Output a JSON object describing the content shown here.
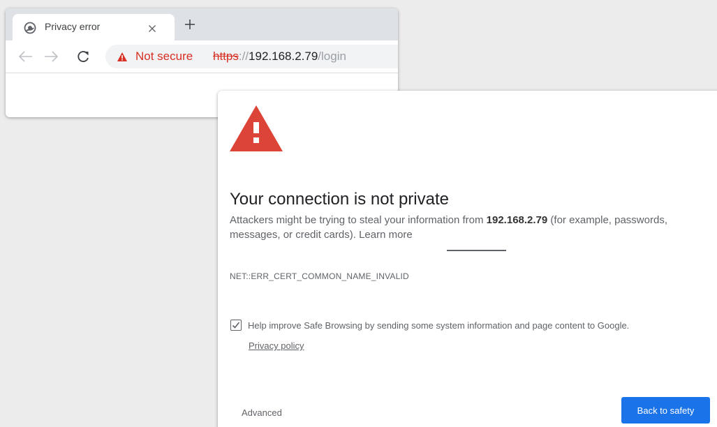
{
  "browser": {
    "tab": {
      "title": "Privacy error"
    },
    "address_bar": {
      "security_label": "Not secure",
      "url_scheme": "https",
      "url_separator": "://",
      "url_host": "192.168.2.79",
      "url_path": "/login"
    }
  },
  "interstitial": {
    "heading": "Your connection is not private",
    "explanation_prefix": "Attackers might be trying to steal your information from ",
    "explanation_host": "192.168.2.79",
    "explanation_suffix": " (for example, passwords, messages, or credit cards). ",
    "learn_more": "Learn more",
    "error_code": "NET::ERR_CERT_COMMON_NAME_INVALID",
    "safe_browsing_label": "Help improve Safe Browsing by sending some system information and page content to Google.",
    "safe_browsing_checked": true,
    "privacy_policy": "Privacy policy",
    "advanced": "Advanced",
    "back_to_safety": "Back to safety"
  },
  "colors": {
    "warning_red": "#db4437",
    "not_secure_red": "#d93025",
    "primary_blue": "#1a73e8"
  }
}
